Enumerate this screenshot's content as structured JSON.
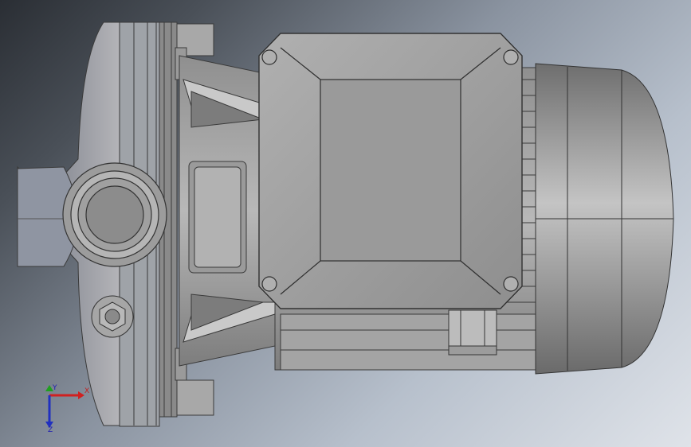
{
  "view": {
    "background_top": "#2a2e34",
    "background_bottom": "#dfe3e9",
    "model_fill": "#a3a3a3",
    "model_stroke": "#3a3a3a"
  },
  "triad": {
    "x_label": "X",
    "y_label": "Y",
    "z_label": "Z",
    "x_color": "#d02020",
    "y_color": "#20a020",
    "z_color": "#2030c0"
  }
}
